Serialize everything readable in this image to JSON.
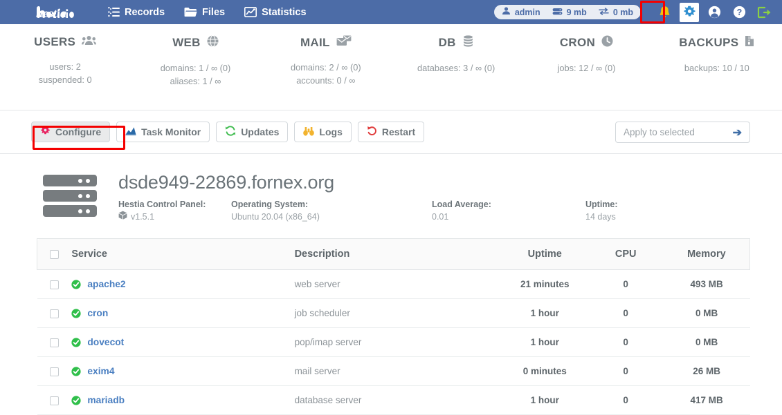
{
  "header": {
    "logo_alt": "hestia",
    "nav": [
      {
        "label": "Records",
        "icon": "list-icon"
      },
      {
        "label": "Files",
        "icon": "folder-icon"
      },
      {
        "label": "Statistics",
        "icon": "chart-icon"
      }
    ],
    "user_pill": {
      "user": "admin",
      "disk": "9 mb",
      "bandwidth": "0 mb"
    },
    "icons": [
      {
        "name": "notifications-icon",
        "glyph": "bell"
      },
      {
        "name": "server-settings-icon",
        "glyph": "gear"
      },
      {
        "name": "user-account-icon",
        "glyph": "user"
      },
      {
        "name": "help-icon",
        "glyph": "question"
      },
      {
        "name": "logout-icon",
        "glyph": "logout"
      }
    ],
    "colors": {
      "bar": "#4c6ca7",
      "pill_bg": "#e9edf4",
      "bell": "#f5c20a",
      "logout": "#8bd142",
      "highlight": "#f40000"
    }
  },
  "stats": [
    {
      "title": "USERS",
      "icon": "users-icon",
      "lines": [
        "users: 2",
        "suspended: 0"
      ]
    },
    {
      "title": "WEB",
      "icon": "globe-icon",
      "lines": [
        "domains: 1 / ∞ (0)",
        "aliases: 1 / ∞"
      ]
    },
    {
      "title": "MAIL",
      "icon": "mail-icon",
      "lines": [
        "domains: 2 / ∞ (0)",
        "accounts: 0 / ∞"
      ]
    },
    {
      "title": "DB",
      "icon": "database-icon",
      "lines": [
        "databases: 3 / ∞ (0)",
        ""
      ]
    },
    {
      "title": "CRON",
      "icon": "clock-icon",
      "lines": [
        "jobs: 12 / ∞ (0)",
        ""
      ]
    },
    {
      "title": "BACKUPS",
      "icon": "archive-icon",
      "lines": [
        "backups: 10 / 10",
        ""
      ]
    }
  ],
  "toolbar": {
    "buttons": [
      {
        "label": "Configure",
        "icon": "gear-icon",
        "selected": true,
        "icon_color": "#e8205f"
      },
      {
        "label": "Task Monitor",
        "icon": "monitor-icon",
        "selected": false,
        "icon_color": "#2a6aa8"
      },
      {
        "label": "Updates",
        "icon": "refresh-icon",
        "selected": false,
        "icon_color": "#3dbb4d"
      },
      {
        "label": "Logs",
        "icon": "binocular-icon",
        "selected": false,
        "icon_color": "#f2b32e"
      },
      {
        "label": "Restart",
        "icon": "restart-icon",
        "selected": false,
        "icon_color": "#e03a3a"
      }
    ],
    "apply_placeholder": "Apply to selected",
    "apply_arrow": "➔"
  },
  "server": {
    "hostname": "dsde949-22869.fornex.org",
    "meta": [
      {
        "key": "Hestia Control Panel:",
        "value": "v1.5.1",
        "icon": "package-icon"
      },
      {
        "key": "Operating System:",
        "value": "Ubuntu 20.04 (x86_64)",
        "icon": ""
      },
      {
        "key": "Load Average:",
        "value": "0.01",
        "icon": ""
      },
      {
        "key": "Uptime:",
        "value": "14 days",
        "icon": ""
      }
    ]
  },
  "table": {
    "columns": [
      "Service",
      "Description",
      "Uptime",
      "CPU",
      "Memory"
    ],
    "rows": [
      {
        "service": "apache2",
        "status": "running",
        "description": "web server",
        "uptime": "21 minutes",
        "cpu": "0",
        "memory": "493 MB"
      },
      {
        "service": "cron",
        "status": "running",
        "description": "job scheduler",
        "uptime": "1 hour",
        "cpu": "0",
        "memory": "0 MB"
      },
      {
        "service": "dovecot",
        "status": "running",
        "description": "pop/imap server",
        "uptime": "1 hour",
        "cpu": "0",
        "memory": "0 MB"
      },
      {
        "service": "exim4",
        "status": "running",
        "description": "mail server",
        "uptime": "0 minutes",
        "cpu": "0",
        "memory": "26 MB"
      },
      {
        "service": "mariadb",
        "status": "running",
        "description": "database server",
        "uptime": "1 hour",
        "cpu": "0",
        "memory": "417 MB"
      }
    ]
  }
}
